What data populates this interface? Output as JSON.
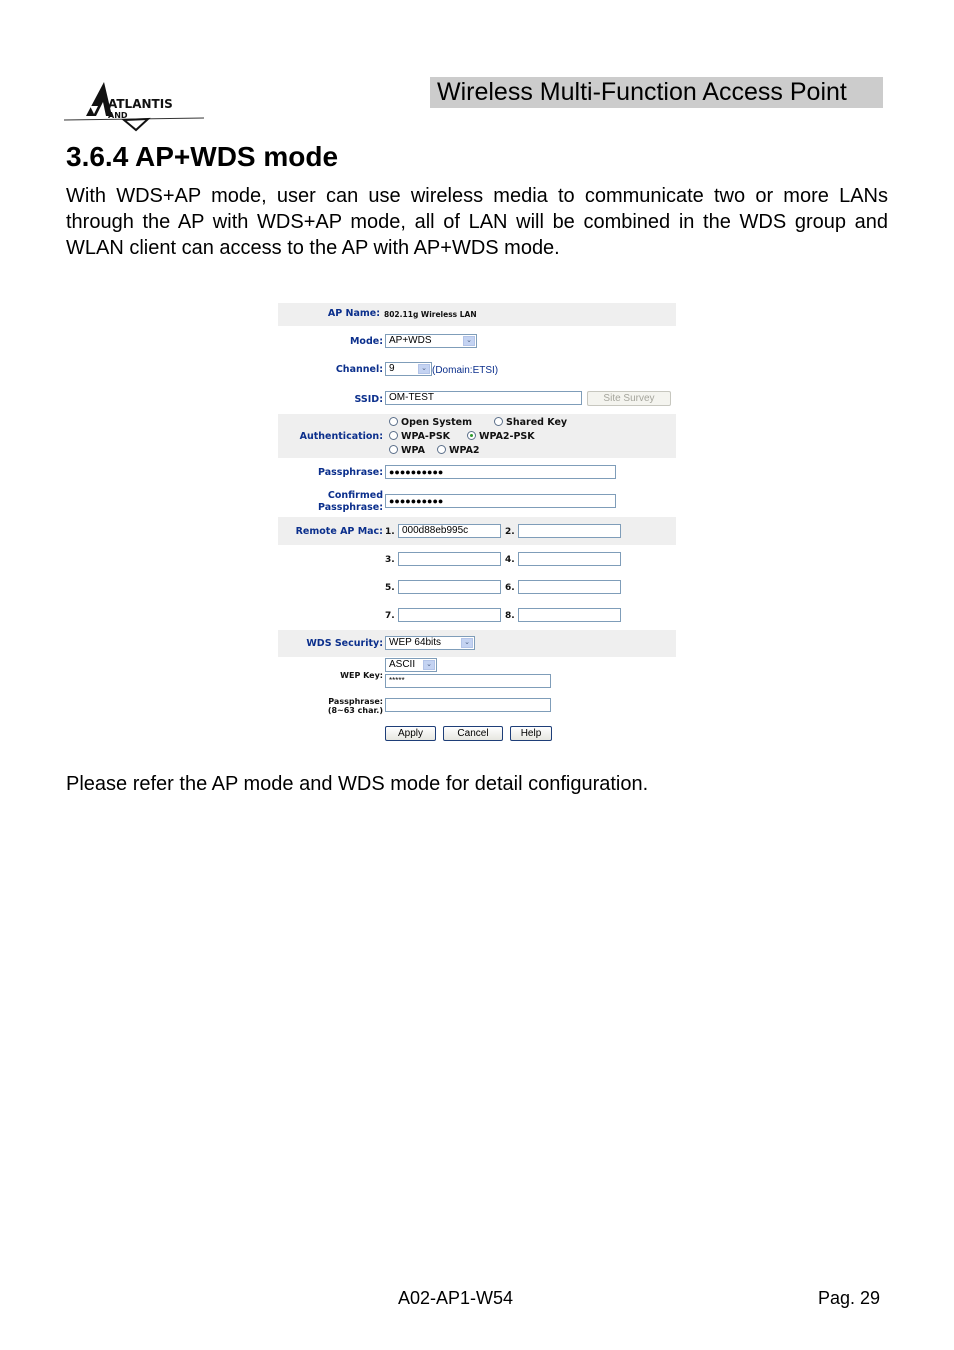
{
  "header": {
    "logo_text": "ATLANTIS",
    "logo_subtext": "AND",
    "product_title": "Wireless Multi-Function Access Point"
  },
  "section": {
    "title": "3.6.4  AP+WDS mode",
    "intro": "With WDS+AP mode, user can use wireless media to communicate two or more LANs through the AP with WDS+AP mode, all of LAN will be combined in the WDS group and WLAN client can access to the AP with AP+WDS mode.",
    "outro": "Please refer the AP mode and WDS mode for detail configuration."
  },
  "form": {
    "ap_name_label": "AP Name:",
    "ap_name_value": "802.11g Wireless LAN",
    "mode_label": "Mode:",
    "mode_value": "AP+WDS",
    "channel_label": "Channel:",
    "channel_value": "9",
    "channel_domain": "(Domain:ETSI)",
    "ssid_label": "SSID:",
    "ssid_value": "OM-TEST",
    "site_survey_label": "Site Survey",
    "auth_label": "Authentication:",
    "auth_options": [
      {
        "label": "Open System",
        "selected": false
      },
      {
        "label": "Shared Key",
        "selected": false
      },
      {
        "label": "WPA-PSK",
        "selected": false
      },
      {
        "label": "WPA2-PSK",
        "selected": true
      },
      {
        "label": "WPA",
        "selected": false
      },
      {
        "label": "WPA2",
        "selected": false
      }
    ],
    "passphrase_label": "Passphrase:",
    "passphrase_value": "●●●●●●●●●●",
    "confirmed_label_1": "Confirmed",
    "confirmed_label_2": "Passphrase:",
    "confirmed_value": "●●●●●●●●●●",
    "remote_mac_label": "Remote AP Mac:",
    "remote_macs": [
      {
        "num": "1.",
        "value": "000d88eb995c"
      },
      {
        "num": "2.",
        "value": ""
      },
      {
        "num": "3.",
        "value": ""
      },
      {
        "num": "4.",
        "value": ""
      },
      {
        "num": "5.",
        "value": ""
      },
      {
        "num": "6.",
        "value": ""
      },
      {
        "num": "7.",
        "value": ""
      },
      {
        "num": "8.",
        "value": ""
      }
    ],
    "wds_security_label": "WDS Security:",
    "wds_security_value": "WEP 64bits",
    "wep_key_label": "WEP Key:",
    "wep_key_format": "ASCII",
    "wep_key_value": "*****",
    "wds_passphrase_label_1": "Passphrase:",
    "wds_passphrase_label_2": "(8~63 char.)",
    "wds_passphrase_value": "",
    "apply_label": "Apply",
    "cancel_label": "Cancel",
    "help_label": "Help"
  },
  "footer": {
    "model": "A02-AP1-W54",
    "page": "Pag. 29"
  }
}
